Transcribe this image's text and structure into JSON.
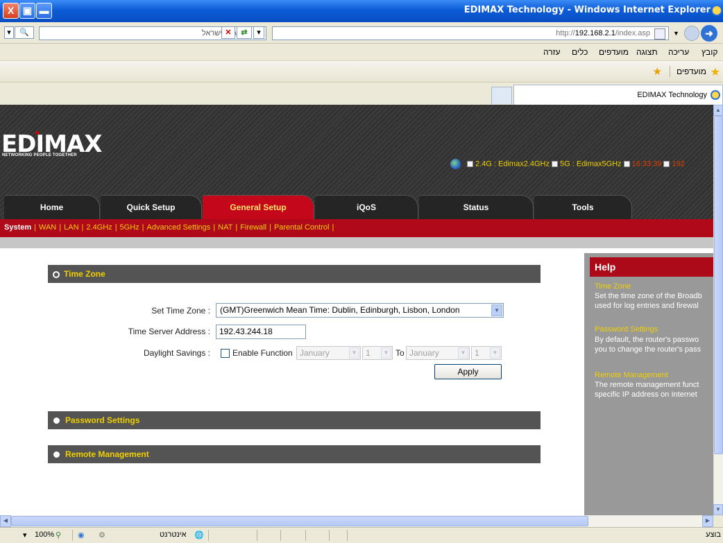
{
  "window": {
    "title": "EDIMAX Technology - Windows Internet Explorer",
    "close_glyph": "X"
  },
  "addressbar": {
    "search_placeholder": "גוגל ישראל",
    "url_prefix": "http://",
    "url_host": "192.168.2.1",
    "url_path": "/index.asp"
  },
  "menu": {
    "items": [
      "קובץ",
      "עריכה",
      "תצוגה",
      "מועדפים",
      "כלים",
      "עזרה"
    ]
  },
  "favorites": {
    "label": "מועדפים"
  },
  "tab": {
    "title": "EDIMAX Technology"
  },
  "router": {
    "logo": "EDIMAX",
    "tagline": "NETWORKING PEOPLE TOGETHER",
    "status": {
      "ssid24": "2.4G : Edimax2.4GHz",
      "ssid5": "5G : Edimax5GHz",
      "time": "16:33:39",
      "ip_partial": "192"
    },
    "nav_tabs": [
      "Home",
      "Quick Setup",
      "General Setup",
      "iQoS",
      "Status",
      "Tools"
    ],
    "active_tab": "General Setup",
    "subnav": [
      "System",
      "WAN",
      "LAN",
      "2.4GHz",
      "5GHz",
      "Advanced Settings",
      "NAT",
      "Firewall",
      "Parental Control"
    ],
    "active_subnav": "System",
    "sections": {
      "time_zone": "Time Zone",
      "password": "Password Settings",
      "remote": "Remote Management"
    },
    "form": {
      "tz_label": "Set Time Zone :",
      "tz_value": "(GMT)Greenwich Mean Time: Dublin, Edinburgh, Lisbon, London",
      "ts_label": "Time Server Address :",
      "ts_value": "192.43.244.18",
      "dst_label": "Daylight Savings :",
      "dst_checkbox": "Enable Function",
      "dst_checked": false,
      "from_month": "January",
      "from_day": "1",
      "to_label": "To",
      "to_month": "January",
      "to_day": "1",
      "apply": "Apply"
    },
    "help": {
      "heading": "Help",
      "tz_title": "Time Zone",
      "tz_line1": "Set the time zone of the Broadb",
      "tz_line2": "used for log entries and firewal",
      "pw_title": "Password Settings",
      "pw_line1": "By default, the router's passwo",
      "pw_line2": "you to change the router's pass",
      "rm_title": "Remote Management",
      "rm_line1": "The remote management funct",
      "rm_line2": "specific IP address on Internet"
    }
  },
  "statusbar": {
    "zoom": "100%",
    "zone": "אינטרנט",
    "done": "בוצע"
  },
  "colors": {
    "title_blue": "#0b5bd7",
    "router_red": "#b0091a",
    "router_yellow": "#f0d000",
    "section_gray": "#545454",
    "help_gray": "#999999"
  }
}
